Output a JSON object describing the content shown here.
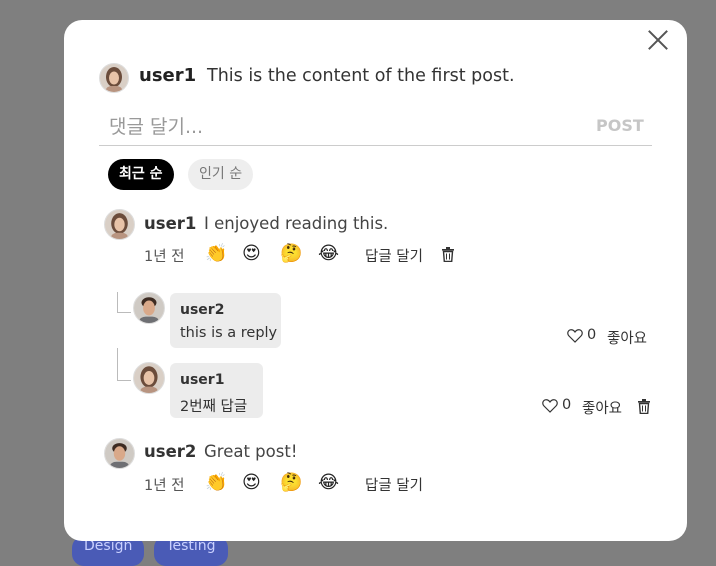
{
  "background": {
    "tags": [
      "Design",
      "Testing"
    ]
  },
  "post": {
    "user": "user1",
    "content": "This is the content of the first post."
  },
  "comment_input": {
    "placeholder": "댓글 달기...",
    "post_label": "POST"
  },
  "sort": {
    "recent": "최근 순",
    "popular": "인기 순"
  },
  "emojis": [
    "👏",
    "😍",
    "🤔",
    "😂"
  ],
  "comments": [
    {
      "user": "user1",
      "text": "I enjoyed reading this.",
      "time": "1년 전",
      "reply_label": "답글 달기",
      "replies": [
        {
          "user": "user2",
          "text": "this is a reply",
          "likes": "0",
          "like_label": "좋아요"
        },
        {
          "user": "user1",
          "text": "2번째 답글",
          "likes": "0",
          "like_label": "좋아요"
        }
      ]
    },
    {
      "user": "user2",
      "text": "Great post!",
      "time": "1년 전",
      "reply_label": "답글 달기"
    }
  ]
}
